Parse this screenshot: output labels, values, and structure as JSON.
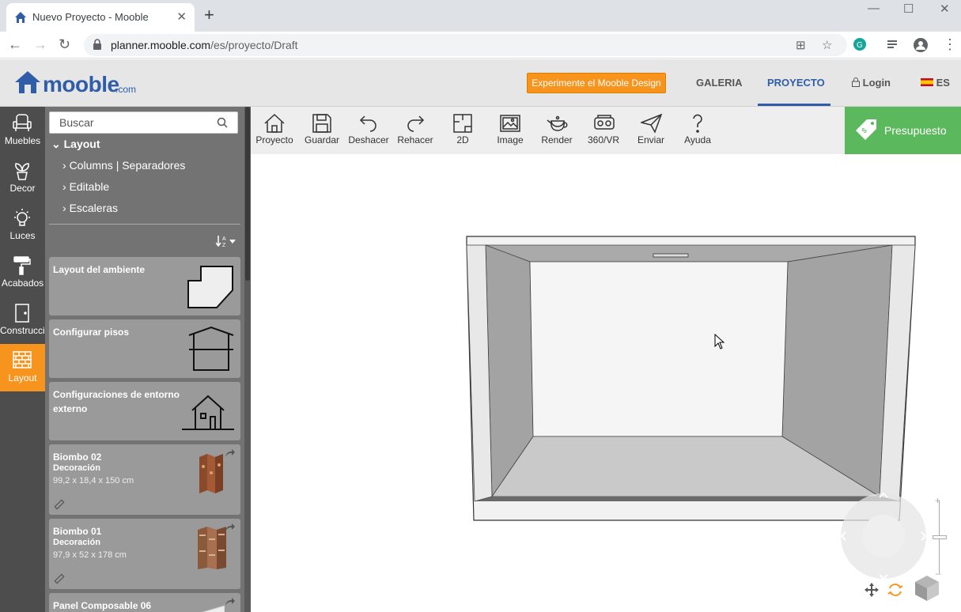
{
  "browser": {
    "tab_title": "Nuevo Proyecto - Mooble",
    "url_host": "planner.mooble.com",
    "url_path": "/es/proyecto/Draft"
  },
  "header": {
    "logo_text": "mooble",
    "logo_suffix": ".com",
    "cta_label": "Experimente el Mooble Design",
    "nav": [
      "GALERIA",
      "PROYECTO"
    ],
    "active_nav": "PROYECTO",
    "login_label": "Login",
    "lang_label": "ES"
  },
  "leftnav": {
    "items": [
      {
        "label": "Muebles",
        "icon": "armchair-icon"
      },
      {
        "label": "Decor",
        "icon": "plant-icon"
      },
      {
        "label": "Luces",
        "icon": "lightbulb-icon"
      },
      {
        "label": "Acabados",
        "icon": "paint-roller-icon"
      },
      {
        "label": "Construcción",
        "icon": "door-icon"
      },
      {
        "label": "Layout",
        "icon": "brick-wall-icon"
      }
    ],
    "active": "Layout"
  },
  "panel": {
    "search_placeholder": "Buscar",
    "tree_root": "Layout",
    "tree_items": [
      "Columns | Separadores",
      "Editable",
      "Escaleras"
    ],
    "cards": [
      {
        "title": "Layout del ambiente",
        "icon": "room-layout-icon"
      },
      {
        "title": "Configurar pisos",
        "icon": "floors-icon"
      },
      {
        "title": "Configuraciones de entorno externo",
        "icon": "house-icon"
      },
      {
        "title": "Biombo 02",
        "category": "Decoración",
        "dimensions": "99,2 x 18,4 x 150 cm"
      },
      {
        "title": "Biombo 01",
        "category": "Decoración",
        "dimensions": "97,9 x 52 x 178 cm"
      },
      {
        "title": "Panel Composable 06"
      }
    ]
  },
  "tools": [
    {
      "label": "Proyecto",
      "icon": "home-icon"
    },
    {
      "label": "Guardar",
      "icon": "save-icon"
    },
    {
      "label": "Deshacer",
      "icon": "undo-icon"
    },
    {
      "label": "Rehacer",
      "icon": "redo-icon"
    },
    {
      "label": "2D",
      "icon": "floorplan-icon"
    },
    {
      "label": "Image",
      "icon": "image-icon"
    },
    {
      "label": "Render",
      "icon": "teapot-icon"
    },
    {
      "label": "360/VR",
      "icon": "vr-headset-icon"
    },
    {
      "label": "Enviar",
      "icon": "send-icon"
    },
    {
      "label": "Ayuda",
      "icon": "help-icon"
    }
  ],
  "budget_label": "Presupuesto",
  "colors": {
    "accent_orange": "#f7941d",
    "brand_blue": "#2f5da8",
    "budget_green": "#5cb85c",
    "sidebar_dark": "#4d4d4d",
    "panel_gray": "#737373"
  }
}
